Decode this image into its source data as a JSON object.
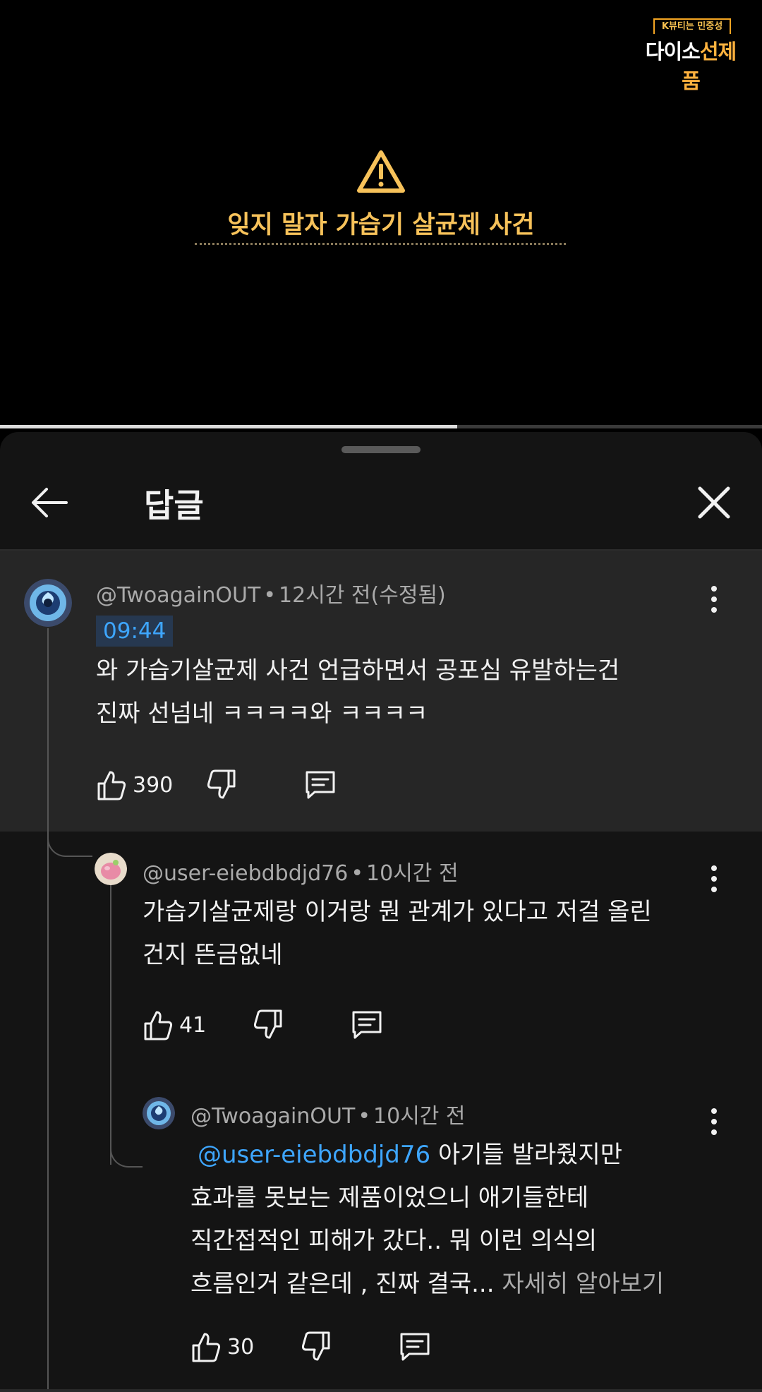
{
  "video": {
    "badge_top": "K뷰티는 민중성",
    "badge_main_a": "다이소",
    "badge_main_b": "선제품",
    "warning_text": "잊지 말자 가습기 살균제 사건",
    "progress": 0.6
  },
  "panel": {
    "title": "답글",
    "back_icon": "arrow-left-icon",
    "close_icon": "close-icon"
  },
  "comments": [
    {
      "author": "@TwoagainOUT",
      "time": "12시간 전(수정됨)",
      "timestamp": "09:44",
      "lines": [
        "와 가습기살균제 사건 언급하면서 공포심 유발하는건",
        "진짜 선넘네 ㅋㅋㅋㅋ와 ㅋㅋㅋㅋ"
      ],
      "likes": "390"
    },
    {
      "author": "@user-eiebdbdjd76",
      "time": "10시간 전",
      "lines": [
        "가습기살균제랑 이거랑 뭔 관계가 있다고 저걸 올린",
        "건지 뜬금없네"
      ],
      "likes": "41"
    },
    {
      "author": "@TwoagainOUT",
      "time": "10시간 전",
      "mention": "@user-eiebdbdjd76",
      "line1_rest": " 아기들 발라줬지만",
      "lines": [
        "효과를 못보는 제품이었으니 애기들한테",
        "직간접적인 피해가 갔다..  뭐 이런 의식의"
      ],
      "line4": "흐름인거 같은데 , 진짜 결국...",
      "read_more": " 자세히 알아보기",
      "likes": "30"
    }
  ],
  "separator": "•"
}
